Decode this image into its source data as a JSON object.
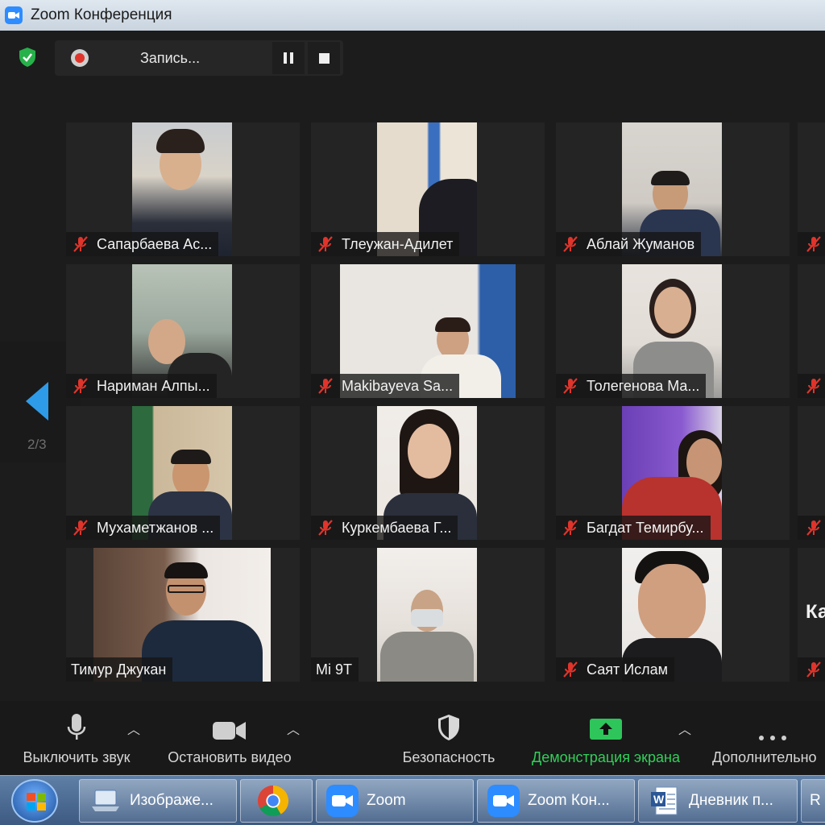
{
  "window": {
    "title": "Zoom Конференция"
  },
  "recording": {
    "label": "Запись..."
  },
  "pager": {
    "page": "2/3"
  },
  "participants": [
    {
      "name": "Сапарбаева Ас..."
    },
    {
      "name": "Тлеужан-Адилет"
    },
    {
      "name": "Аблай Жуманов"
    },
    {
      "name": "Нариман Алпы..."
    },
    {
      "name": "Makibayeva Sa..."
    },
    {
      "name": "Толегенова Ма..."
    },
    {
      "name": "Мухаметжанов ..."
    },
    {
      "name": "Куркембаева Г..."
    },
    {
      "name": "Багдат Темирбу..."
    },
    {
      "name": "Тимур Джукан"
    },
    {
      "name": "Mi 9T"
    },
    {
      "name": "Саят Ислам"
    }
  ],
  "partial_tile": {
    "name": "Ка"
  },
  "toolbar": {
    "mute_label": "Выключить звук",
    "video_label": "Остановить видео",
    "security_label": "Безопасность",
    "share_label": "Демонстрация экрана",
    "more_label": "Дополнительно"
  },
  "taskbar": {
    "items": [
      {
        "label": "Изображе..."
      },
      {
        "label": ""
      },
      {
        "label": "Zoom"
      },
      {
        "label": "Zoom Кон..."
      },
      {
        "label": "Дневник п..."
      },
      {
        "label": "R"
      }
    ]
  },
  "colors": {
    "accent_blue": "#2e9be8",
    "share_green": "#31d05a",
    "muted_red": "#e0342b"
  }
}
